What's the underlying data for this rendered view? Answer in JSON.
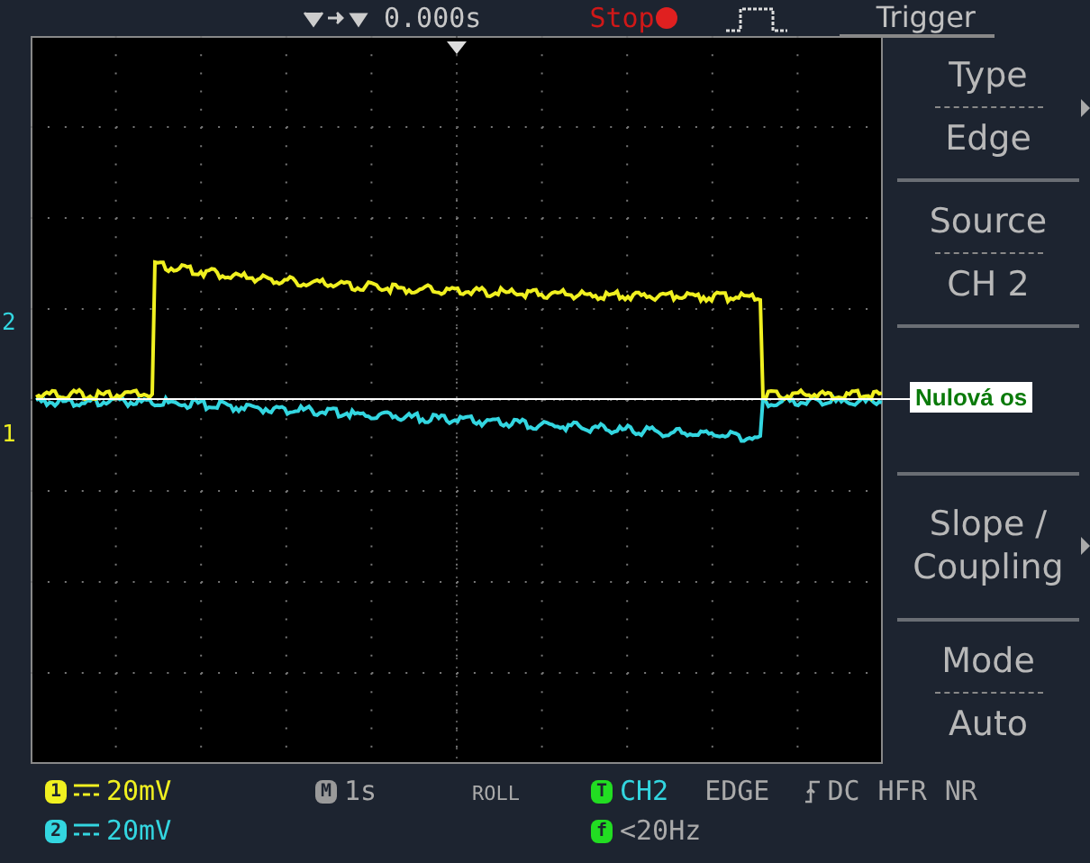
{
  "top_bar": {
    "trigger_position": "0.000s",
    "run_state": "Stop",
    "running": false
  },
  "menu": {
    "title": "Trigger",
    "items": [
      {
        "kind": "pair",
        "label": "Type",
        "value": "Edge",
        "submenu": true
      },
      {
        "kind": "pair",
        "label": "Source",
        "value": "CH 2"
      },
      {
        "kind": "empty"
      },
      {
        "kind": "single",
        "lines": [
          "Slope /",
          "Coupling"
        ],
        "submenu": true
      },
      {
        "kind": "pair",
        "label": "Mode",
        "value": "Auto"
      }
    ]
  },
  "channel_markers": [
    {
      "label": "2",
      "color": "#33d6e0"
    },
    {
      "label": "1",
      "color": "#f0f020"
    }
  ],
  "annotation": {
    "label": "Nulová os"
  },
  "status": {
    "channels": [
      {
        "number": "1",
        "scale": "20mV",
        "color": "#f0f020"
      },
      {
        "number": "2",
        "scale": "20mV",
        "color": "#33d6e0"
      }
    ],
    "timebase": {
      "badge": "M",
      "value": "1s"
    },
    "mode": "ROLL",
    "trigger": {
      "badge": "T",
      "source": "CH2",
      "type": "EDGE",
      "coupling": "DC",
      "hfr": "HFR",
      "nr": "NR",
      "freq_badge": "f",
      "frequency": "<20Hz"
    }
  }
}
